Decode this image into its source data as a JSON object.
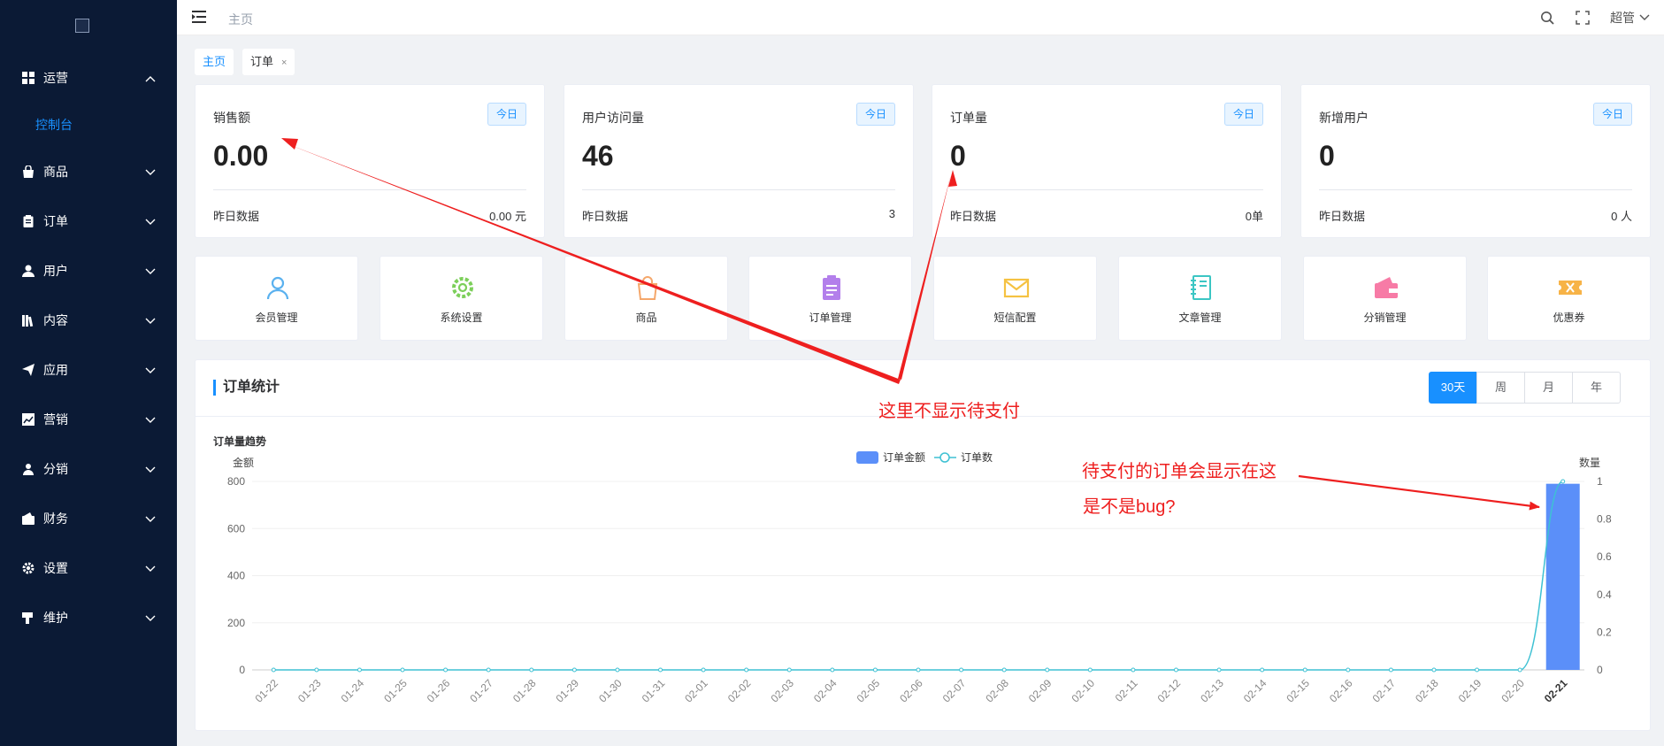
{
  "header": {
    "breadcrumb": "主页",
    "user": "超管"
  },
  "sidebar": {
    "items": [
      {
        "label": "运营",
        "icon": "grid-icon",
        "expanded": true,
        "children": [
          "控制台"
        ]
      },
      {
        "label": "商品",
        "icon": "bag-icon"
      },
      {
        "label": "订单",
        "icon": "clipboard-icon"
      },
      {
        "label": "用户",
        "icon": "user-icon"
      },
      {
        "label": "内容",
        "icon": "book-icon"
      },
      {
        "label": "应用",
        "icon": "paper-plane-icon"
      },
      {
        "label": "营销",
        "icon": "trend-icon"
      },
      {
        "label": "分销",
        "icon": "person-icon"
      },
      {
        "label": "财务",
        "icon": "wallet-icon"
      },
      {
        "label": "设置",
        "icon": "gear-icon"
      },
      {
        "label": "维护",
        "icon": "hammer-icon"
      }
    ]
  },
  "tags": [
    {
      "label": "主页",
      "active": true
    },
    {
      "label": "订单",
      "close": "×"
    }
  ],
  "stats": [
    {
      "title": "销售额",
      "badge": "今日",
      "value": "0.00",
      "foot_label": "昨日数据",
      "foot_value": "0.00 元"
    },
    {
      "title": "用户访问量",
      "badge": "今日",
      "value": "46",
      "foot_label": "昨日数据",
      "foot_value": "3"
    },
    {
      "title": "订单量",
      "badge": "今日",
      "value": "0",
      "foot_label": "昨日数据",
      "foot_value": "0单"
    },
    {
      "title": "新增用户",
      "badge": "今日",
      "value": "0",
      "foot_label": "昨日数据",
      "foot_value": "0 人"
    }
  ],
  "quick_links": [
    {
      "label": "会员管理",
      "icon": "member-icon",
      "color": "#5ab1ef"
    },
    {
      "label": "系统设置",
      "icon": "settings-icon",
      "color": "#7ccf5a"
    },
    {
      "label": "商品",
      "icon": "shopping-bag-icon",
      "color": "#f5a76b"
    },
    {
      "label": "订单管理",
      "icon": "order-icon",
      "color": "#b37feb"
    },
    {
      "label": "短信配置",
      "icon": "mail-icon",
      "color": "#f5c242"
    },
    {
      "label": "文章管理",
      "icon": "notebook-icon",
      "color": "#3cc6c4"
    },
    {
      "label": "分销管理",
      "icon": "wallet-icon",
      "color": "#f77ba6"
    },
    {
      "label": "优惠券",
      "icon": "ticket-icon",
      "color": "#f7b347"
    }
  ],
  "order_panel": {
    "title": "订单统计",
    "ranges": [
      "30天",
      "周",
      "月",
      "年"
    ],
    "active_range": "30天",
    "subtitle": "订单量趋势"
  },
  "chart_data": {
    "type": "bar",
    "legend_position": "top-center",
    "categories": [
      "01-22",
      "01-23",
      "01-24",
      "01-25",
      "01-26",
      "01-27",
      "01-28",
      "01-29",
      "01-30",
      "01-31",
      "02-01",
      "02-02",
      "02-03",
      "02-04",
      "02-05",
      "02-06",
      "02-07",
      "02-08",
      "02-09",
      "02-10",
      "02-11",
      "02-12",
      "02-13",
      "02-14",
      "02-15",
      "02-16",
      "02-17",
      "02-18",
      "02-19",
      "02-20",
      "02-21"
    ],
    "series": [
      {
        "name": "订单金额",
        "type": "bar",
        "axis": "left",
        "color": "#5b8ff9",
        "values": [
          0,
          0,
          0,
          0,
          0,
          0,
          0,
          0,
          0,
          0,
          0,
          0,
          0,
          0,
          0,
          0,
          0,
          0,
          0,
          0,
          0,
          0,
          0,
          0,
          0,
          0,
          0,
          0,
          0,
          0,
          790
        ]
      },
      {
        "name": "订单数",
        "type": "line",
        "axis": "right",
        "color": "#3ec1d3",
        "values": [
          0,
          0,
          0,
          0,
          0,
          0,
          0,
          0,
          0,
          0,
          0,
          0,
          0,
          0,
          0,
          0,
          0,
          0,
          0,
          0,
          0,
          0,
          0,
          0,
          0,
          0,
          0,
          0,
          0,
          0,
          1
        ]
      }
    ],
    "y_left": {
      "label": "金额",
      "ticks": [
        0,
        200,
        400,
        600,
        800
      ],
      "range": [
        0,
        800
      ]
    },
    "y_right": {
      "label": "数量",
      "ticks": [
        0,
        0.2,
        0.4,
        0.6,
        0.8,
        1
      ],
      "range": [
        0,
        1
      ]
    },
    "grid": true
  },
  "annotations": {
    "note1": "这里不显示待支付",
    "note2_line1": "待支付的订单会显示在这",
    "note2_line2": "是不是bug?",
    "color": "#ee1f1f"
  }
}
